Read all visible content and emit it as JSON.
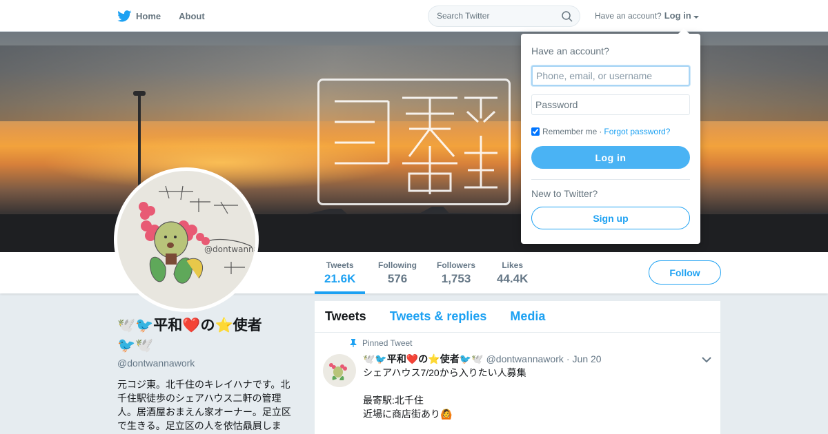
{
  "nav": {
    "home_label": "Home",
    "about_label": "About",
    "search_placeholder": "Search Twitter",
    "have_account": "Have an account?",
    "login_label": "Log in",
    "brand_color": "#1da1f2"
  },
  "profile": {
    "display_name": "🕊️🐦平和❤️の⭐使者🐦🕊️",
    "handle": "@dontwannawork",
    "bio": "元コジ東。北千住のキレイハナです。北千住駅徒歩のシェアハウス二軒の管理人。居酒屋おまえん家オーナー。足立区で生きる。足立区の人を依怙贔屓しま"
  },
  "stats": [
    {
      "label": "Tweets",
      "value": "21.6K"
    },
    {
      "label": "Following",
      "value": "576"
    },
    {
      "label": "Followers",
      "value": "1,753"
    },
    {
      "label": "Likes",
      "value": "44.4K"
    }
  ],
  "follow_label": "Follow",
  "tabs": [
    {
      "label": "Tweets"
    },
    {
      "label": "Tweets & replies"
    },
    {
      "label": "Media"
    }
  ],
  "tweet": {
    "pinned_label": "Pinned Tweet",
    "author_name": "🕊️🐦平和❤️の⭐使者🐦🕊️",
    "author_handle": "@dontwannawork",
    "date": "Jun 20",
    "text": "シェアハウス7/20から入りたい人募集\n\n最寄駅:北千住\n近場に商店街あり🙆"
  },
  "login_dropdown": {
    "title": "Have an account?",
    "username_placeholder": "Phone, email, or username",
    "password_placeholder": "Password",
    "remember_label": "Remember me",
    "separator": "·",
    "forgot_label": "Forgot password?",
    "login_button": "Log in",
    "new_label": "New to Twitter?",
    "signup_button": "Sign up"
  }
}
